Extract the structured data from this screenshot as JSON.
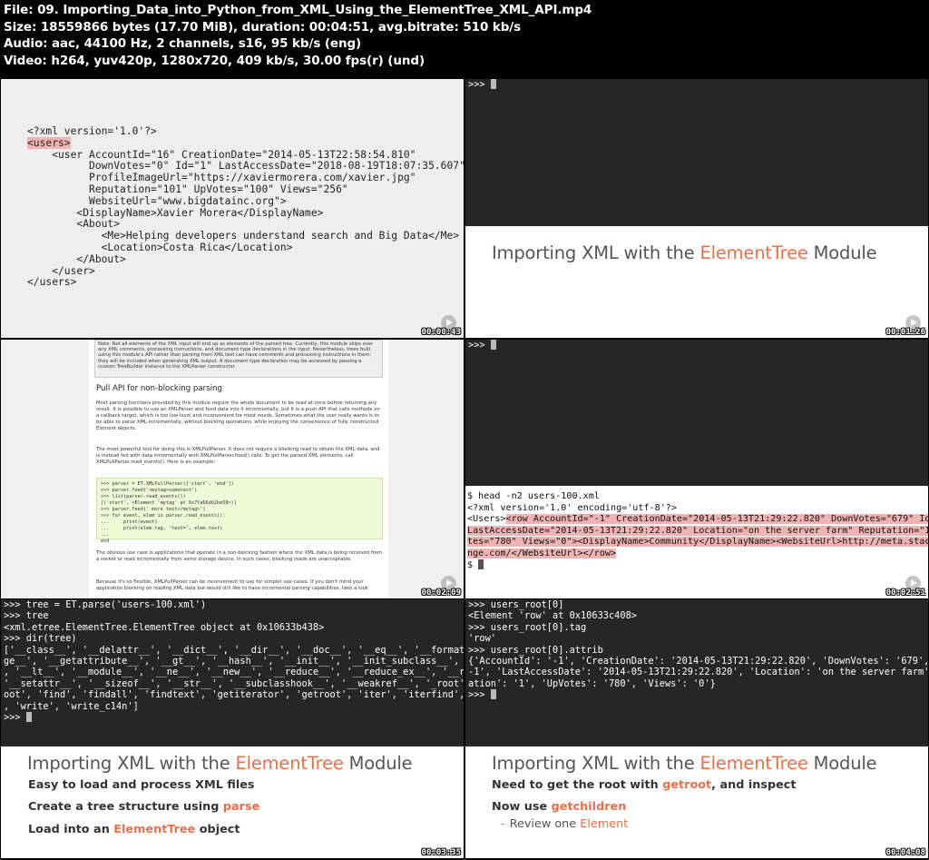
{
  "header": {
    "file_line": "File: 09. Importing_Data_into_Python_from_XML_Using_the_ElementTree_XML_API.mp4",
    "size_line": "Size: 18559866 bytes (17.70 MiB), duration: 00:04:51, avg.bitrate: 510 kb/s",
    "audio_line": "Audio: aac, 44100 Hz, 2 channels, s16, 95 kb/s (eng)",
    "video_line": "Video: h264, yuv420p, 1280x720, 409 kb/s, 30.00 fps(r) (und)"
  },
  "frames": {
    "f1": {
      "timestamp": "00:00:43",
      "code": [
        "<?xml version='1.0'?>",
        "<users>",
        "    <user AccountId=\"16\" CreationDate=\"2014-05-13T22:58:54.810\"",
        "          DownVotes=\"0\" Id=\"1\" LastAccessDate=\"2018-08-19T18:07:35.607\"",
        "          ProfileImageUrl=\"https://xaviermorera.com/xavier.jpg\"",
        "          Reputation=\"101\" UpVotes=\"100\" Views=\"256\"",
        "          WebsiteUrl=\"www.bigdatainc.org\">",
        "        <DisplayName>Xavier Morera</DisplayName>",
        "        <About>",
        "            <Me>Helping developers understand search and Big Data</Me>",
        "            <Location>Costa Rica</Location>",
        "        </About>",
        "    </user>",
        "</users>"
      ]
    },
    "f2": {
      "timestamp": "00:01:26",
      "prompt": ">>> ",
      "slide_title_a": "Importing XML with the ",
      "slide_title_b": "ElementTree",
      "slide_title_c": " Module"
    },
    "f3": {
      "timestamp": "00:02:09",
      "note": "Note: Not all elements of the XML input will end up as elements of the parsed tree. Currently, this module skips over any XML comments, processing instructions, and document type declarations in the input. Nevertheless, trees built using this module's API rather than parsing from XML text can have comments and processing instructions in them; they will be included when generating XML output. A document type declaration may be accessed by passing a custom TreeBuilder instance to the XMLParser constructor.",
      "heading": "Pull API for non-blocking parsing",
      "p1": "Most parsing functions provided by this module require the whole document to be read at once before returning any result. It is possible to use an XMLParser and feed data into it incrementally, but it is a push API that calls methods on a callback target, which is too low-level and inconvenient for most needs. Sometimes what the user really wants is to be able to parse XML incrementally, without blocking operations, while enjoying the convenience of fully constructed Element objects.",
      "p2": "The most powerful tool for doing this is XMLPullParser. It does not require a blocking read to obtain the XML data, and is instead fed with data incrementally with XMLPullParser.feed() calls. To get the parsed XML elements, call XMLPullParser.read_events(). Here is an example:",
      "code": [
        ">>> parser = ET.XMLPullParser(['start', 'end'])",
        ">>> parser.feed('<mytag>sometext')",
        ">>> list(parser.read_events())",
        "[('start', <Element 'mytag' at 0x7fa66db2be58>)]",
        ">>> parser.feed(' more text</mytag>')",
        ">>> for event, elem in parser.read_events():",
        "...     print(event)",
        "...     print(elem.tag, 'text=', elem.text)",
        "...",
        "end"
      ],
      "p3": "The obvious use case is applications that operate in a non-blocking fashion where the XML data is being received from a socket or read incrementally from some storage device. In such cases, blocking reads are unacceptable.",
      "p4": "Because it's so flexible, XMLPullParser can be inconvenient to use for simpler use-cases. If you don't mind your application blocking on reading XML data but would still like to have incremental parsing capabilities, take a look"
    },
    "f4": {
      "timestamp": "00:02:51",
      "prompt_top": ">>> ",
      "cmd": "$ head -n2 users-100.xml",
      "line1": "<?xml version='1.0' encoding='utf-8'?>",
      "line2_a": "<Users>",
      "line2_b": "<row AccountId=\"-1\" CreationDate=\"2014-05-13T21:29:22.820\" DownVotes=\"679\" Id=\"-1\"",
      "line3": "LastAccessDate=\"2014-05-13T21:29:22.820\" Location=\"on the server farm\" Reputation=\"1\" UpVo",
      "line4": "tes=\"780\" Views=\"0\"><DisplayName>Community</DisplayName><WebsiteUrl>http://meta.stackexcha",
      "line5": "nge.com/</WebsiteUrl></row>",
      "prompt_end": "$ "
    },
    "f5": {
      "timestamp": "00:03:35",
      "lines": [
        ">>> tree = ET.parse('users-100.xml')",
        ">>> tree",
        "<xml.etree.ElementTree.ElementTree object at 0x10633b438>",
        ">>> dir(tree)",
        "['__class__', '__delattr__', '__dict__', '__dir__', '__doc__', '__eq__', '__format__', '__",
        "ge__', '__getattribute__', '__gt__', '__hash__', '__init__', '__init_subclass__', '__le__'",
        ", '__lt__', '__module__', '__ne__', '__new__', '__reduce__', '__reduce_ex__', '__repr__',",
        "'__setattr__', '__sizeof__', '__str__', '__subclasshook__', '__weakref__', '_root', '_setr",
        "oot', 'find', 'findall', 'findtext', 'getiterator', 'getroot', 'iter', 'iterfind', 'parse'",
        ", 'write', 'write_c14n']"
      ],
      "prompt": ">>> ",
      "slide_title_a": "Importing XML with the ",
      "slide_title_b": "ElementTree",
      "slide_title_c": " Module",
      "b1_text": "Easy to load and process XML files",
      "b2_text": "Create a tree structure using ",
      "b2_accent": "parse",
      "b3_text": "Load into an ",
      "b3_accent": "ElementTree",
      "b3_tail": " object"
    },
    "f6": {
      "timestamp": "00:04:08",
      "lines": [
        ">>> users_root[0]",
        "<Element 'row' at 0x10633c408>",
        ">>> users_root[0].tag",
        "'row'",
        ">>> users_root[0].attrib",
        "{'AccountId': '-1', 'CreationDate': '2014-05-13T21:29:22.820', 'DownVotes': '679', 'Id': '",
        "-1', 'LastAccessDate': '2014-05-13T21:29:22.820', 'Location': 'on the server farm', 'Reput",
        "ation': '1', 'UpVotes': '780', 'Views': '0'}",
        ">>> "
      ],
      "slide_title_a": "Importing XML with the ",
      "slide_title_b": "ElementTree",
      "slide_title_c": " Module",
      "b1_text": "Need to get the root with ",
      "b1_accent": "getroot",
      "b1_tail": ", and inspect",
      "b2_text": "Now use ",
      "b2_accent": "getchildren",
      "sub_dash": "-",
      "sub_text": "Review one ",
      "sub_accent": "Element"
    }
  }
}
